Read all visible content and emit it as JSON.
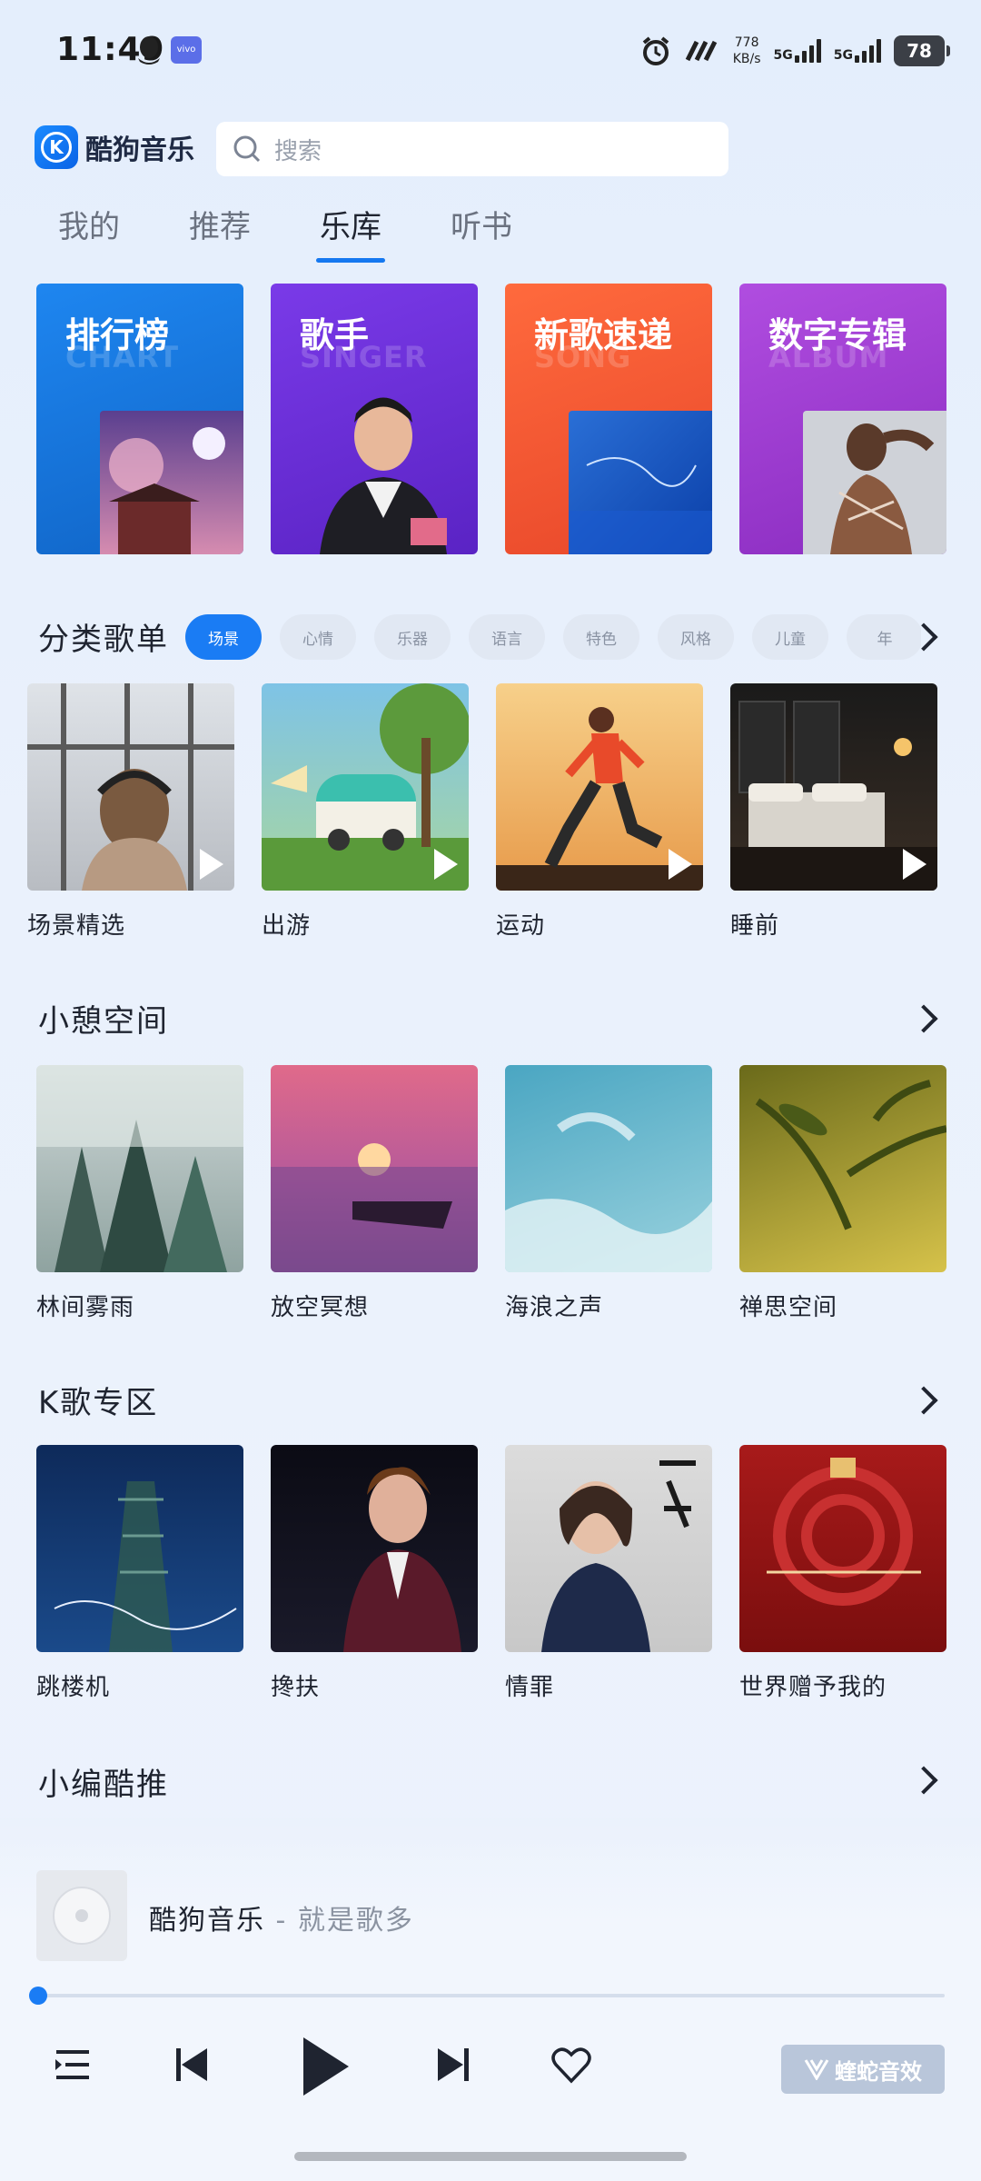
{
  "status": {
    "time": "11:49",
    "speed_top": "778",
    "speed_bottom": "KB/s",
    "net1": "5G",
    "net2": "5G",
    "battery": "78"
  },
  "header": {
    "app_name": "酷狗音乐",
    "search_placeholder": "搜索"
  },
  "tabs": [
    {
      "label": "我的"
    },
    {
      "label": "推荐"
    },
    {
      "label": "乐库"
    },
    {
      "label": "听书"
    }
  ],
  "banners": [
    {
      "title": "排行榜",
      "bg": "CHART"
    },
    {
      "title": "歌手",
      "bg": "SINGER"
    },
    {
      "title": "新歌速递",
      "bg": "SONG"
    },
    {
      "title": "数字专辑",
      "bg": "ALBUM"
    }
  ],
  "playlist_section": {
    "title": "分类歌单",
    "chips": [
      "场景",
      "心情",
      "乐器",
      "语言",
      "特色",
      "风格",
      "儿童",
      "年"
    ],
    "items": [
      {
        "label": "场景精选"
      },
      {
        "label": "出游"
      },
      {
        "label": "运动"
      },
      {
        "label": "睡前"
      }
    ]
  },
  "relax_section": {
    "title": "小憩空间",
    "items": [
      {
        "label": "林间雾雨"
      },
      {
        "label": "放空冥想"
      },
      {
        "label": "海浪之声"
      },
      {
        "label": "禅思空间"
      }
    ]
  },
  "karaoke_section": {
    "title": "K歌专区",
    "items": [
      {
        "label": "跳楼机"
      },
      {
        "label": "搀扶"
      },
      {
        "label": "情罪"
      },
      {
        "label": "世界赠予我的"
      }
    ]
  },
  "editor_section": {
    "title": "小编酷推"
  },
  "player": {
    "title": "酷狗音乐",
    "subtitle": " - 就是歌多",
    "progress": 0.0,
    "effect_label": "蝰蛇音效"
  },
  "colors": {
    "accent": "#1a7cf4"
  }
}
